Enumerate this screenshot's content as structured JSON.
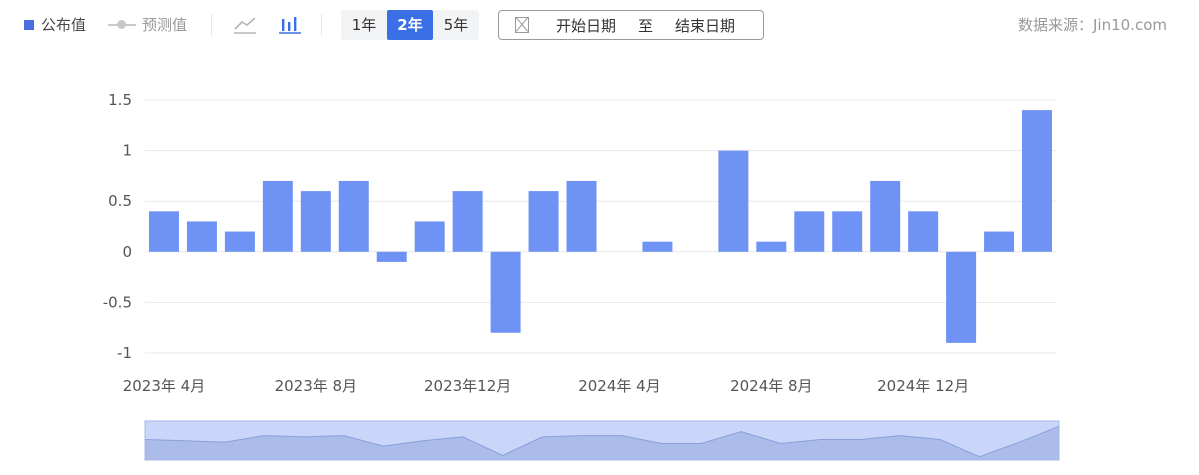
{
  "legend": {
    "published_label": "公布值",
    "forecast_label": "预测值"
  },
  "icons": {
    "line_chart": "line-chart-icon",
    "bar_chart": "bar-chart-icon",
    "calendar": "calendar-icon"
  },
  "ranges": [
    {
      "label": "1年",
      "active": false
    },
    {
      "label": "2年",
      "active": true
    },
    {
      "label": "5年",
      "active": false
    }
  ],
  "date_range": {
    "start_label": "开始日期",
    "separator": "至",
    "end_label": "结束日期"
  },
  "source_label": "数据来源：Jin10.com",
  "colors": {
    "bar": "#6f93f5",
    "accent": "#3b6fe6",
    "navigator_fill": "#c9d6fa",
    "navigator_area": "#a6b7e8"
  },
  "chart_data": {
    "type": "bar",
    "x": [
      "2023-04",
      "2023-05",
      "2023-06",
      "2023-07",
      "2023-08",
      "2023-09",
      "2023-10",
      "2023-11",
      "2023-12",
      "2024-01",
      "2024-02",
      "2024-03",
      "2024-04",
      "2024-05",
      "2024-06",
      "2024-07",
      "2024-08",
      "2024-09",
      "2024-10",
      "2024-11",
      "2024-12",
      "2025-01",
      "2025-02",
      "2025-03"
    ],
    "values": [
      0.4,
      0.3,
      0.2,
      0.7,
      0.6,
      0.7,
      -0.1,
      0.3,
      0.6,
      -0.8,
      0.6,
      0.7,
      null,
      0.1,
      null,
      1.0,
      0.1,
      0.4,
      0.4,
      0.7,
      0.4,
      -0.9,
      0.2,
      1.4
    ],
    "y_ticks": [
      "1.5",
      "1",
      "0.5",
      "0",
      "-0.5",
      "-1"
    ],
    "y_tick_values": [
      1.5,
      1,
      0.5,
      0,
      -0.5,
      -1
    ],
    "ylim": [
      -1,
      1.5
    ],
    "x_tick_labels": [
      {
        "index": 0,
        "label": "2023年 4月"
      },
      {
        "index": 4,
        "label": "2023年 8月"
      },
      {
        "index": 8,
        "label": "2023年12月"
      },
      {
        "index": 12,
        "label": "2024年 4月"
      },
      {
        "index": 16,
        "label": "2024年 8月"
      },
      {
        "index": 20,
        "label": "2024年 12月"
      }
    ],
    "grid": true,
    "legend_position": "top-left"
  }
}
